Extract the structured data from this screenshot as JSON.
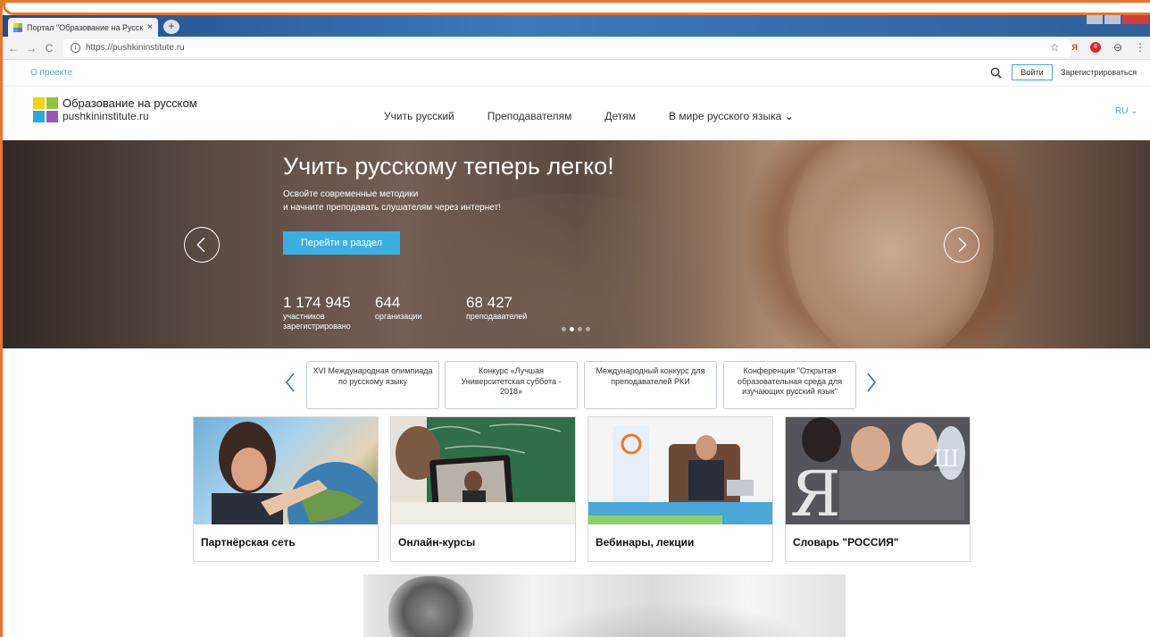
{
  "browser": {
    "tab_title": "Портал \"Образование на Русск",
    "tab_close": "×",
    "new_tab": "+",
    "url": "https://pushkininstitute.ru",
    "nav_back": "←",
    "nav_forward": "→",
    "nav_reload": "C",
    "info_icon": "i",
    "star_icon": "☆",
    "yandex_icon": "Я",
    "rec_badge": "8",
    "profile_icon": "⊖",
    "menu_icon": "⋮"
  },
  "topbar": {
    "about": "О проекте",
    "login": "Войти",
    "register": "Зарегистрироваться"
  },
  "header": {
    "logo_line1": "Образование на русском",
    "logo_line2": "pushkininstitute.ru",
    "nav": [
      {
        "label": "Учить русский"
      },
      {
        "label": "Преподавателям"
      },
      {
        "label": "Детям"
      },
      {
        "label": "В мире русского языка ⌄"
      }
    ],
    "lang": "RU ⌄"
  },
  "hero": {
    "title": "Учить русскому теперь легко!",
    "subtitle_line1": "Освойте современные методики",
    "subtitle_line2": "и начните преподавать слушателям через интернет!",
    "button": "Перейти в раздел",
    "stats": [
      {
        "num": "1 174 945",
        "label1": "участников",
        "label2": "зарегистрировано"
      },
      {
        "num": "644",
        "label1": "организации",
        "label2": ""
      },
      {
        "num": "68 427",
        "label1": "преподавателей",
        "label2": ""
      }
    ],
    "slide_count": 4,
    "active_slide": 1
  },
  "news": [
    {
      "text": "XVI Международная олимпиада по русскому языку"
    },
    {
      "text": "Конкурс «Лучшая Университетская суббота - 2018»"
    },
    {
      "text": "Международный конкурс для преподавателей РКИ"
    },
    {
      "text": "Конференция \"Открытая образовательная среда для изучающих русский язык\""
    }
  ],
  "tiles": [
    {
      "caption": "Партнёрская сеть"
    },
    {
      "caption": "Онлайн-курсы"
    },
    {
      "caption": "Вебинары, лекции"
    },
    {
      "caption": "Словарь \"РОССИЯ\""
    }
  ],
  "colors": {
    "accent": "#3ab0e2",
    "link": "#4aa7d8",
    "logo_yellow": "#f5d40f",
    "logo_green": "#8cc63f",
    "logo_blue": "#29abe2",
    "logo_purple": "#9b59b6"
  }
}
